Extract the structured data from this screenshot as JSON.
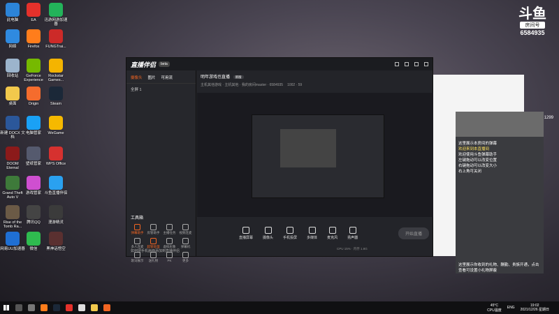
{
  "desktop": {
    "icons": [
      {
        "name": "computer",
        "label": "此电脑",
        "color": "#2c84d8"
      },
      {
        "name": "ea",
        "label": "EA",
        "color": "#e5312b"
      },
      {
        "name": "gamehelper",
        "label": "迅游网游加速器",
        "color": "#23b35a"
      },
      {
        "name": "network",
        "label": "网络",
        "color": "#2f8ae0"
      },
      {
        "name": "firefox",
        "label": "Firefox",
        "color": "#ff7d1b"
      },
      {
        "name": "fung",
        "label": "FUNGTrai...",
        "color": "#cc2a28"
      },
      {
        "name": "recycle",
        "label": "回收站",
        "color": "#9cb4cc"
      },
      {
        "name": "geforce",
        "label": "GeForce Experience",
        "color": "#76b900"
      },
      {
        "name": "rockstar",
        "label": "Rockstar Games...",
        "color": "#f4b400"
      },
      {
        "name": "desktop-folder",
        "label": "桌面",
        "color": "#f2c94c"
      },
      {
        "name": "origin",
        "label": "Origin",
        "color": "#f56c2d"
      },
      {
        "name": "steam",
        "label": "Steam",
        "color": "#1b2838"
      },
      {
        "name": "docx",
        "label": "新建 DOCX 文档",
        "color": "#2b579a"
      },
      {
        "name": "pcmanager",
        "label": "电脑管家",
        "color": "#1aa1f5"
      },
      {
        "name": "wegame",
        "label": "WeGame",
        "color": "#f6b900"
      },
      {
        "name": "doom",
        "label": "DOOM Eternal",
        "color": "#8b1a1a"
      },
      {
        "name": "wallpaper",
        "label": "壁纸管家",
        "color": "#555a6e"
      },
      {
        "name": "wps",
        "label": "WPS Office",
        "color": "#d6312f"
      },
      {
        "name": "gta",
        "label": "Grand Theft Auto V",
        "color": "#3e7a3a"
      },
      {
        "name": "game-master",
        "label": "游戏管家",
        "color": "#cf4fd0"
      },
      {
        "name": "douyu-live",
        "label": "斗鱼直播伴侣",
        "color": "#2aa1f0"
      },
      {
        "name": "tomb",
        "label": "Rise of the Tomb Ra...",
        "color": "#6b5a46"
      },
      {
        "name": "qq",
        "label": "腾讯QQ",
        "color": "#444"
      },
      {
        "name": "tunnel",
        "label": "漫游精灵",
        "color": "#3b3b3b"
      },
      {
        "name": "uu",
        "label": "网易UU加速器",
        "color": "#1f6fd3"
      },
      {
        "name": "wechat",
        "label": "微信",
        "color": "#2fbb4f"
      },
      {
        "name": "black",
        "label": "黑神话悟空",
        "color": "#5a3030"
      }
    ],
    "brand": {
      "logo": "斗鱼",
      "sub": "房间号",
      "room": "6584935"
    }
  },
  "app": {
    "title": "直播伴侣",
    "version": "beta",
    "tabs": [
      "摄像头",
      "图片",
      "可用流"
    ],
    "scene": "全屏 1",
    "tools_title": "工具箱",
    "tools": [
      "弹幕助手",
      "房管助手",
      "主播任务",
      "视频连麦",
      "多人连麦",
      "超管处理",
      "虚拟形象",
      "弹幕机",
      "歌词展示",
      "送礼物",
      "PK",
      "更多"
    ],
    "hot_tools": [
      0,
      5
    ],
    "tip": "如何把手机画面添加到直播伴侣",
    "room": {
      "name": "明年游戏也直播",
      "tag": "新版",
      "meta": "主机其他游戏 · 主机其他 · 我的房间master · 6584935",
      "stats": "1002 · 59"
    },
    "bottom": [
      "直播屏幕",
      "摄像头",
      "手机投屏",
      "多媒体",
      "麦克风",
      "扬声器"
    ],
    "start": "开始直播",
    "status": "CPU 15% · 内存 1.8G"
  },
  "chat": {
    "viewers": "1299",
    "lines": [
      {
        "text": "这里展示本房间的弹幕",
        "y": false
      },
      {
        "text": "欢迎来到本直播间",
        "y": true
      },
      {
        "text": "欢迎使用斗鱼弹幕助手",
        "y": false
      },
      {
        "text": "左键拖动可以改变位置",
        "y": false
      },
      {
        "text": "右键拖动可以改变大小",
        "y": false
      },
      {
        "text": "右上角可关闭",
        "y": false
      }
    ],
    "notice": "这里展示你收到的礼物、酬勤、贵族开通，点击查看可设置小礼物屏蔽"
  },
  "taskbar": {
    "temp": "45°C",
    "cpu": "CPU温度",
    "lang": "ENG",
    "time": "19:02",
    "date": "2021/12/26 星期日"
  }
}
